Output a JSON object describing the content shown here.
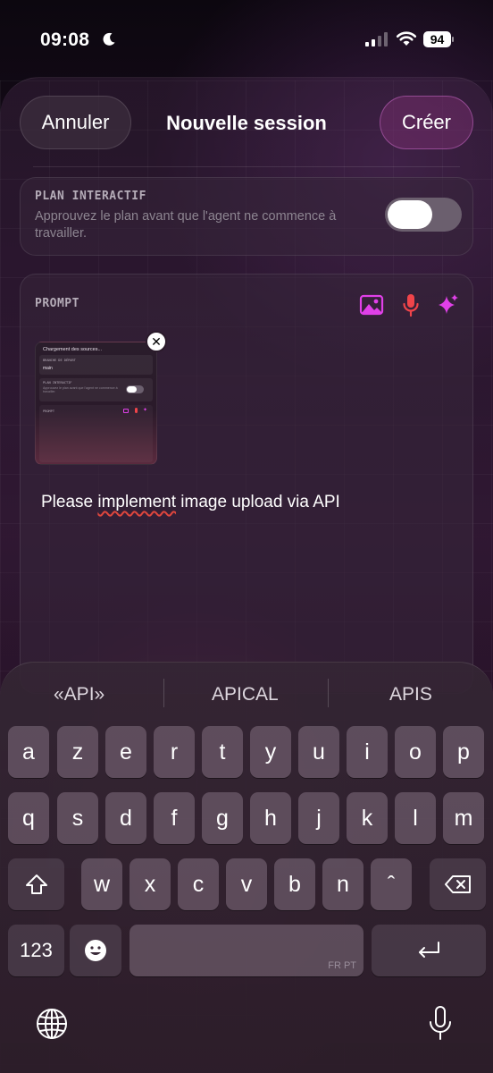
{
  "status_bar": {
    "time": "09:08",
    "battery": "94"
  },
  "header": {
    "cancel_label": "Annuler",
    "title": "Nouvelle session",
    "create_label": "Créer"
  },
  "plan": {
    "label": "PLAN INTERACTIF",
    "description": "Approuvez le plan avant que l'agent ne commence à travailler.",
    "toggle_on": false
  },
  "prompt": {
    "label": "PROMPT",
    "icons": [
      "image-icon",
      "microphone-icon",
      "sparkles-icon"
    ],
    "attachment": {
      "title": "Chargement des sources...",
      "branch_label": "BRANCHE DE DÉPART",
      "branch_value": "main",
      "plan_label": "PLAN INTERACTIF",
      "plan_desc": "Approuvez le plan avant que l'agent ne commence à travailler.",
      "prompt_label": "PROMPT"
    },
    "text_before": "Please ",
    "text_underlined": "implement",
    "text_after": " image upload via API"
  },
  "keyboard": {
    "suggestions": [
      "«API»",
      "APICAL",
      "APIS"
    ],
    "row1": [
      "a",
      "z",
      "e",
      "r",
      "t",
      "y",
      "u",
      "i",
      "o",
      "p"
    ],
    "row2": [
      "q",
      "s",
      "d",
      "f",
      "g",
      "h",
      "j",
      "k",
      "l",
      "m"
    ],
    "row3": [
      "w",
      "x",
      "c",
      "v",
      "b",
      "n",
      "ˆ"
    ],
    "numbers_label": "123",
    "space_langs": "FR PT"
  },
  "colors": {
    "accent_magenta": "#e040e8",
    "mic_red": "#f0444a"
  }
}
